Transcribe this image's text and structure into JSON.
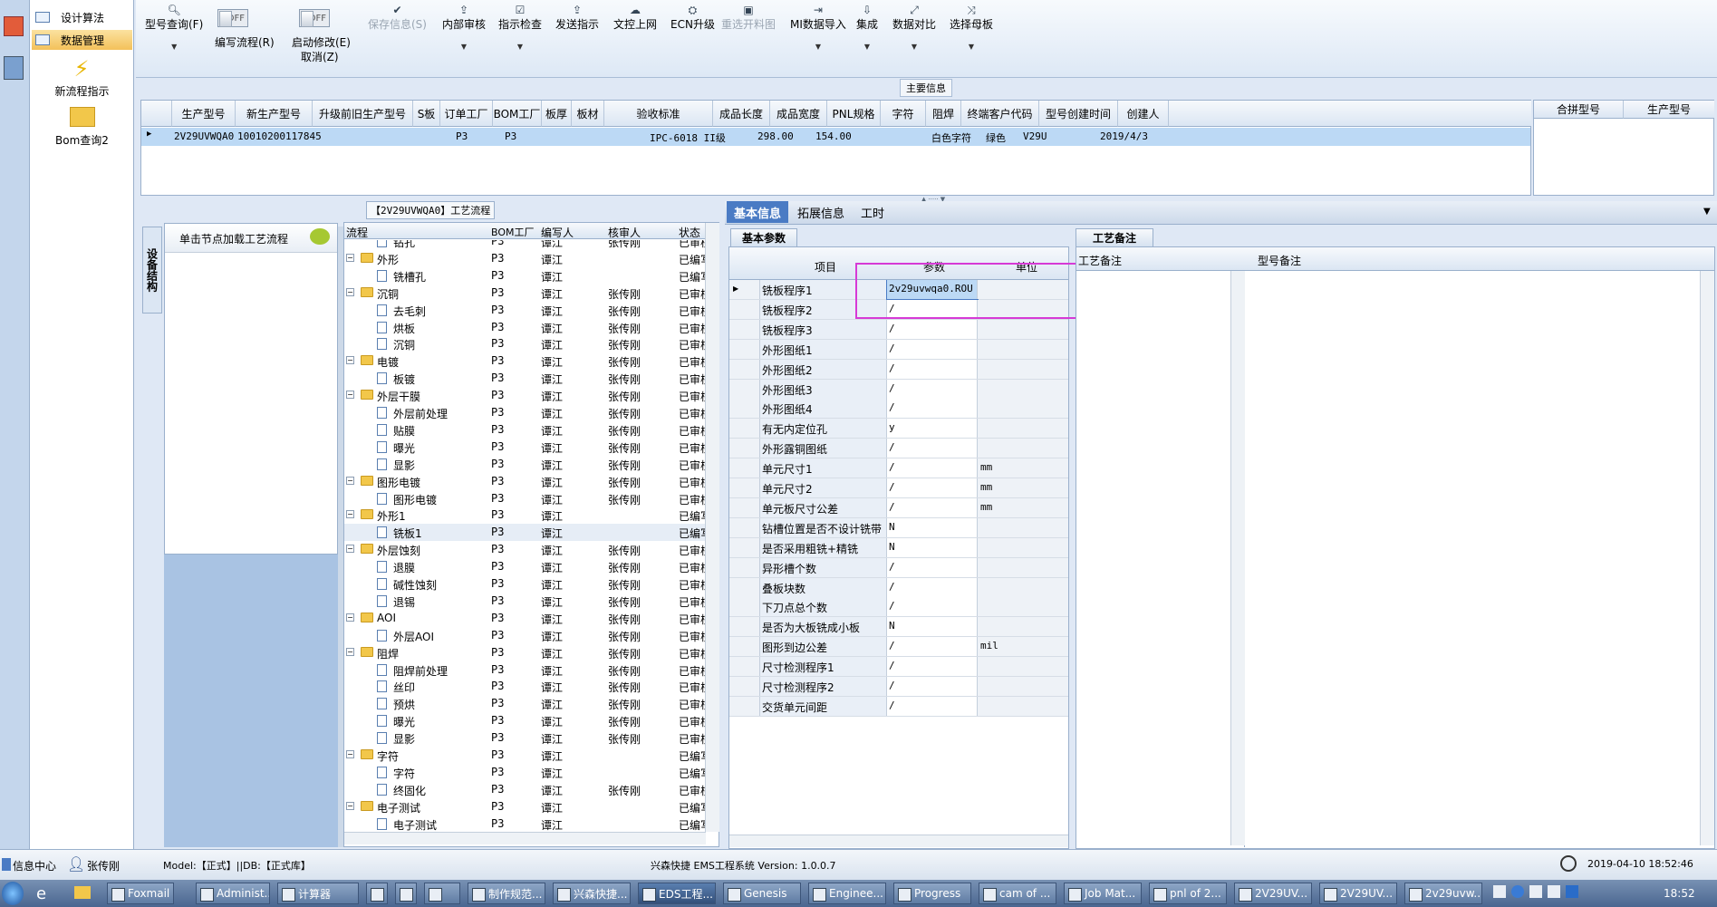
{
  "nav": {
    "items": [
      "设计算法",
      "数据管理"
    ],
    "tools": [
      "新流程指示",
      "Bom查询2"
    ]
  },
  "toolbar": {
    "buttons": [
      {
        "label": "型号查询(F)",
        "icon": "search-icon",
        "dropdown": true
      },
      {
        "label": "编写流程(R)",
        "toggle": "OFF"
      },
      {
        "label": "启动修改(E)",
        "label2": "取消(Z)",
        "toggle": "OFF"
      },
      {
        "label": "保存信息(S)",
        "icon": "check-icon",
        "disabled": true
      },
      {
        "label": "内部审核",
        "icon": "upload-icon",
        "dropdown": true
      },
      {
        "label": "指示检查",
        "icon": "check-icon",
        "dropdown": true
      },
      {
        "label": "发送指示",
        "icon": "send-icon"
      },
      {
        "label": "文控上网",
        "icon": "cloud-upload-icon"
      },
      {
        "label": "ECN升级",
        "icon": "upgrade-icon"
      },
      {
        "label": "重选开料图",
        "icon": "image-icon",
        "disabled": true
      },
      {
        "label": "MI数据导入",
        "icon": "import-icon",
        "dropdown": true
      },
      {
        "label": "集成",
        "icon": "download-icon",
        "dropdown": true
      },
      {
        "label": "数据对比",
        "icon": "compare-icon",
        "dropdown": true
      },
      {
        "label": "选择母板",
        "icon": "shuffle-icon",
        "dropdown": true
      }
    ],
    "group_label": "主要信息"
  },
  "main_table": {
    "headers": [
      "生产型号",
      "新生产型号",
      "升级前旧生产型号",
      "S板",
      "订单工厂",
      "BOM工厂",
      "板厚",
      "板材",
      "验收标准",
      "成品长度",
      "成品宽度",
      "PNL规格",
      "字符",
      "阻焊",
      "终端客户代码",
      "型号创建时间",
      "创建人"
    ],
    "row": [
      "2V29UVWQA0",
      "10010200117845",
      "",
      "",
      "P3",
      "P3",
      "",
      "",
      "IPC-6018 II级",
      "298.00",
      "154.00",
      "",
      "白色字符",
      "绿色",
      "V29U",
      "2019/4/3",
      ""
    ]
  },
  "merge_table": {
    "headers": [
      "合拼型号",
      "生产型号"
    ]
  },
  "flow": {
    "title": "【2V29UVWQA0】工艺流程",
    "side_tab": "设备结构",
    "hint": "单击节点加载工艺流程",
    "headers": [
      "流程",
      "BOM工厂",
      "编写人",
      "核审人",
      "状态"
    ],
    "rows": [
      {
        "name": "钻孔",
        "level": 1,
        "type": "doc",
        "plant": "P3",
        "writer": "谭江",
        "reviewer": "张传刚",
        "status": "已审核"
      },
      {
        "name": "外形",
        "level": 0,
        "type": "folder",
        "plant": "P3",
        "writer": "谭江",
        "reviewer": "",
        "status": "已编写"
      },
      {
        "name": "铣槽孔",
        "level": 1,
        "type": "doc",
        "plant": "P3",
        "writer": "谭江",
        "reviewer": "",
        "status": "已编写"
      },
      {
        "name": "沉铜",
        "level": 0,
        "type": "folder",
        "plant": "P3",
        "writer": "谭江",
        "reviewer": "张传刚",
        "status": "已审核"
      },
      {
        "name": "去毛刺",
        "level": 1,
        "type": "doc",
        "plant": "P3",
        "writer": "谭江",
        "reviewer": "张传刚",
        "status": "已审核"
      },
      {
        "name": "烘板",
        "level": 1,
        "type": "doc",
        "plant": "P3",
        "writer": "谭江",
        "reviewer": "张传刚",
        "status": "已审核"
      },
      {
        "name": "沉铜",
        "level": 1,
        "type": "doc",
        "plant": "P3",
        "writer": "谭江",
        "reviewer": "张传刚",
        "status": "已审核"
      },
      {
        "name": "电镀",
        "level": 0,
        "type": "folder",
        "plant": "P3",
        "writer": "谭江",
        "reviewer": "张传刚",
        "status": "已审核"
      },
      {
        "name": "板镀",
        "level": 1,
        "type": "doc",
        "plant": "P3",
        "writer": "谭江",
        "reviewer": "张传刚",
        "status": "已审核"
      },
      {
        "name": "外层干膜",
        "level": 0,
        "type": "folder",
        "plant": "P3",
        "writer": "谭江",
        "reviewer": "张传刚",
        "status": "已审核"
      },
      {
        "name": "外层前处理",
        "level": 1,
        "type": "doc",
        "plant": "P3",
        "writer": "谭江",
        "reviewer": "张传刚",
        "status": "已审核"
      },
      {
        "name": "贴膜",
        "level": 1,
        "type": "doc",
        "plant": "P3",
        "writer": "谭江",
        "reviewer": "张传刚",
        "status": "已审核"
      },
      {
        "name": "曝光",
        "level": 1,
        "type": "doc",
        "plant": "P3",
        "writer": "谭江",
        "reviewer": "张传刚",
        "status": "已审核"
      },
      {
        "name": "显影",
        "level": 1,
        "type": "doc",
        "plant": "P3",
        "writer": "谭江",
        "reviewer": "张传刚",
        "status": "已审核"
      },
      {
        "name": "图形电镀",
        "level": 0,
        "type": "folder",
        "plant": "P3",
        "writer": "谭江",
        "reviewer": "张传刚",
        "status": "已审核"
      },
      {
        "name": "图形电镀",
        "level": 1,
        "type": "doc",
        "plant": "P3",
        "writer": "谭江",
        "reviewer": "张传刚",
        "status": "已审核"
      },
      {
        "name": "外形1",
        "level": 0,
        "type": "folder",
        "plant": "P3",
        "writer": "谭江",
        "reviewer": "",
        "status": "已编写"
      },
      {
        "name": "铣板1",
        "level": 1,
        "type": "doc",
        "plant": "P3",
        "writer": "谭江",
        "reviewer": "",
        "status": "已编写",
        "selected": true
      },
      {
        "name": "外层蚀刻",
        "level": 0,
        "type": "folder",
        "plant": "P3",
        "writer": "谭江",
        "reviewer": "张传刚",
        "status": "已审核"
      },
      {
        "name": "退膜",
        "level": 1,
        "type": "doc",
        "plant": "P3",
        "writer": "谭江",
        "reviewer": "张传刚",
        "status": "已审核"
      },
      {
        "name": "碱性蚀刻",
        "level": 1,
        "type": "doc",
        "plant": "P3",
        "writer": "谭江",
        "reviewer": "张传刚",
        "status": "已审核"
      },
      {
        "name": "退锡",
        "level": 1,
        "type": "doc",
        "plant": "P3",
        "writer": "谭江",
        "reviewer": "张传刚",
        "status": "已审核"
      },
      {
        "name": "AOI",
        "level": 0,
        "type": "folder",
        "plant": "P3",
        "writer": "谭江",
        "reviewer": "张传刚",
        "status": "已审核"
      },
      {
        "name": "外层AOI",
        "level": 1,
        "type": "doc",
        "plant": "P3",
        "writer": "谭江",
        "reviewer": "张传刚",
        "status": "已审核"
      },
      {
        "name": "阻焊",
        "level": 0,
        "type": "folder",
        "plant": "P3",
        "writer": "谭江",
        "reviewer": "张传刚",
        "status": "已审核"
      },
      {
        "name": "阻焊前处理",
        "level": 1,
        "type": "doc",
        "plant": "P3",
        "writer": "谭江",
        "reviewer": "张传刚",
        "status": "已审核"
      },
      {
        "name": "丝印",
        "level": 1,
        "type": "doc",
        "plant": "P3",
        "writer": "谭江",
        "reviewer": "张传刚",
        "status": "已审核"
      },
      {
        "name": "预烘",
        "level": 1,
        "type": "doc",
        "plant": "P3",
        "writer": "谭江",
        "reviewer": "张传刚",
        "status": "已审核"
      },
      {
        "name": "曝光",
        "level": 1,
        "type": "doc",
        "plant": "P3",
        "writer": "谭江",
        "reviewer": "张传刚",
        "status": "已审核"
      },
      {
        "name": "显影",
        "level": 1,
        "type": "doc",
        "plant": "P3",
        "writer": "谭江",
        "reviewer": "张传刚",
        "status": "已审核"
      },
      {
        "name": "字符",
        "level": 0,
        "type": "folder",
        "plant": "P3",
        "writer": "谭江",
        "reviewer": "",
        "status": "已编写"
      },
      {
        "name": "字符",
        "level": 1,
        "type": "doc",
        "plant": "P3",
        "writer": "谭江",
        "reviewer": "",
        "status": "已编写"
      },
      {
        "name": "终固化",
        "level": 1,
        "type": "doc",
        "plant": "P3",
        "writer": "谭江",
        "reviewer": "张传刚",
        "status": "已审核"
      },
      {
        "name": "电子测试",
        "level": 0,
        "type": "folder",
        "plant": "P3",
        "writer": "谭江",
        "reviewer": "",
        "status": "已编写"
      },
      {
        "name": "电子测试",
        "level": 1,
        "type": "doc",
        "plant": "P3",
        "writer": "谭江",
        "reviewer": "",
        "status": "已编写"
      }
    ]
  },
  "info": {
    "tabs": [
      "基本信息",
      "拓展信息",
      "工时"
    ],
    "subtab": "基本参数",
    "headers": [
      "项目",
      "参数",
      "单位"
    ],
    "rows": [
      {
        "item": "铣板程序1",
        "param": "2v29uvwqa0.ROU",
        "unit": ""
      },
      {
        "item": "铣板程序2",
        "param": "/",
        "unit": ""
      },
      {
        "item": "铣板程序3",
        "param": "/",
        "unit": ""
      },
      {
        "item": "外形图纸1",
        "param": "/",
        "unit": ""
      },
      {
        "item": "外形图纸2",
        "param": "/",
        "unit": ""
      },
      {
        "item": "外形图纸3",
        "param": "/",
        "unit": ""
      },
      {
        "item": "外形图纸4",
        "param": "/",
        "unit": ""
      },
      {
        "item": "有无内定位孔",
        "param": "y",
        "unit": ""
      },
      {
        "item": "外形露铜图纸",
        "param": "/",
        "unit": ""
      },
      {
        "item": "单元尺寸1",
        "param": "/",
        "unit": "mm"
      },
      {
        "item": "单元尺寸2",
        "param": "/",
        "unit": "mm"
      },
      {
        "item": "单元板尺寸公差",
        "param": "/",
        "unit": "mm"
      },
      {
        "item": "钻槽位置是否不设计铣带",
        "param": "N",
        "unit": ""
      },
      {
        "item": "是否采用粗铣+精铣",
        "param": "N",
        "unit": ""
      },
      {
        "item": "异形槽个数",
        "param": "/",
        "unit": ""
      },
      {
        "item": "叠板块数",
        "param": "/",
        "unit": ""
      },
      {
        "item": "下刀点总个数",
        "param": "/",
        "unit": ""
      },
      {
        "item": "是否为大板铣成小板",
        "param": "N",
        "unit": ""
      },
      {
        "item": "图形到边公差",
        "param": "/",
        "unit": "mil"
      },
      {
        "item": "尺寸检测程序1",
        "param": "/",
        "unit": ""
      },
      {
        "item": "尺寸检测程序2",
        "param": "/",
        "unit": ""
      },
      {
        "item": "交货单元间距",
        "param": "/",
        "unit": ""
      }
    ],
    "remark_tab": "工艺备注",
    "remark_headers": [
      "工艺备注",
      "型号备注"
    ]
  },
  "status": {
    "info_center": "信息中心",
    "user": "张传刚",
    "model": "Model:【正式】||DB:【正式库】",
    "app": "兴森快捷  EMS工程系统  Version: 1.0.0.7",
    "datetime": "2019-04-10 18:52:46"
  },
  "taskbar": {
    "items": [
      "Foxmail",
      "Administ...",
      "计算器",
      "",
      "",
      "",
      "制作规范...",
      "兴森快捷...",
      "EDS工程...",
      "Genesis",
      "Enginee...",
      "Progress",
      "cam of ...",
      "Job Mat...",
      "pnl of 2...",
      "2V29UV...",
      "2V29UV...",
      "2v29uvw..."
    ],
    "clock": "18:52"
  },
  "colors": {
    "selection": "#bcd9f5",
    "highlight_box": "#d63ad6",
    "tab_active": "#4a7bc4"
  }
}
